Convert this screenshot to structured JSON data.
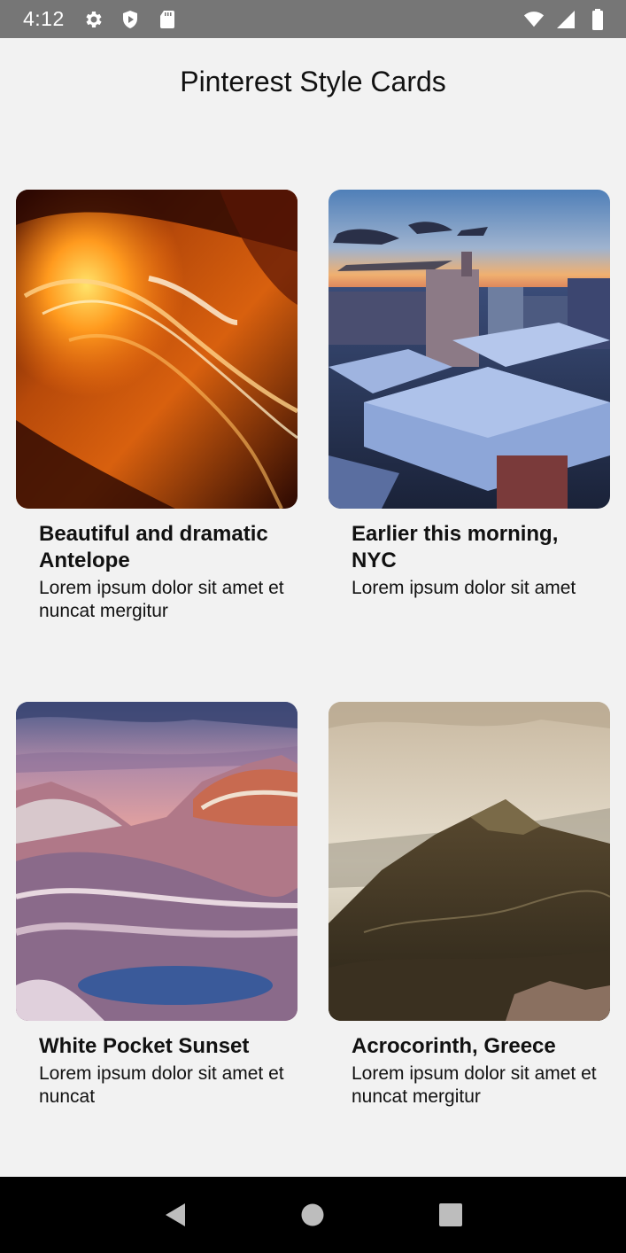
{
  "status_bar": {
    "time": "4:12",
    "left_icons": [
      "gear-icon",
      "shield-icon",
      "sd-card-icon"
    ],
    "right_icons": [
      "wifi-icon",
      "cell-signal-icon",
      "battery-icon"
    ]
  },
  "page": {
    "title": "Pinterest Style Cards"
  },
  "cards": [
    {
      "title": "Beautiful and dramatic Antelope",
      "description": "Lorem ipsum dolor sit amet et nuncat mergitur",
      "image": "antelope-canyon"
    },
    {
      "title": "Earlier this morning, NYC",
      "description": "Lorem ipsum dolor sit amet",
      "image": "nyc-rooftops"
    },
    {
      "title": "White Pocket Sunset",
      "description": "Lorem ipsum dolor sit amet et nuncat",
      "image": "white-pocket"
    },
    {
      "title": "Acrocorinth, Greece",
      "description": "Lorem ipsum dolor sit amet et nuncat mergitur",
      "image": "acrocorinth"
    }
  ],
  "nav_bar": {
    "buttons": [
      "back-icon",
      "home-icon",
      "recents-icon"
    ]
  },
  "colors": {
    "status_bar_bg": "#767676",
    "page_bg": "#f2f2f2",
    "nav_bar_bg": "#000000"
  }
}
